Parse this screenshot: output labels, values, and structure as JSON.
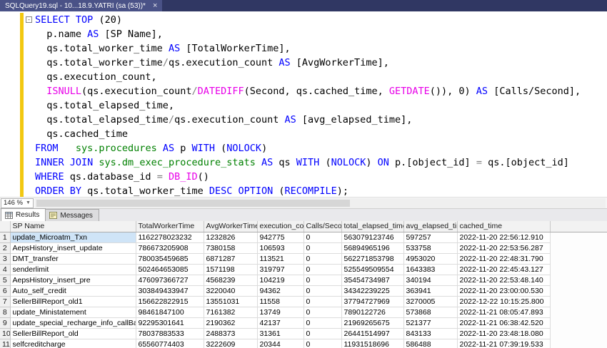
{
  "window": {
    "tab_title": "SQLQuery19.sql - 10...18.9.YATRI (sa (53))*",
    "close_glyph": "×"
  },
  "editor": {
    "zoom": "146 %",
    "code_lines": [
      {
        "fold": "-",
        "tokens": [
          [
            "k",
            "SELECT"
          ],
          [
            "d",
            " "
          ],
          [
            "k",
            "TOP"
          ],
          [
            "d",
            " (20)"
          ]
        ]
      },
      {
        "tokens": [
          [
            "d",
            "  p.name "
          ],
          [
            "k",
            "AS"
          ],
          [
            "d",
            " [SP Name],"
          ]
        ]
      },
      {
        "tokens": [
          [
            "d",
            "  qs.total_worker_time "
          ],
          [
            "k",
            "AS"
          ],
          [
            "d",
            " [TotalWorkerTime],"
          ]
        ]
      },
      {
        "tokens": [
          [
            "d",
            "  qs.total_worker_time"
          ],
          [
            "o",
            "/"
          ],
          [
            "d",
            "qs.execution_count "
          ],
          [
            "k",
            "AS"
          ],
          [
            "d",
            " [AvgWorkerTime],"
          ]
        ]
      },
      {
        "tokens": [
          [
            "d",
            "  qs.execution_count,"
          ]
        ]
      },
      {
        "tokens": [
          [
            "d",
            "  "
          ],
          [
            "f",
            "ISNULL"
          ],
          [
            "d",
            "(qs.execution_count"
          ],
          [
            "o",
            "/"
          ],
          [
            "f",
            "DATEDIFF"
          ],
          [
            "d",
            "(Second, qs.cached_time, "
          ],
          [
            "f",
            "GETDATE"
          ],
          [
            "d",
            "()), 0) "
          ],
          [
            "k",
            "AS"
          ],
          [
            "d",
            " [Calls/Second],"
          ]
        ]
      },
      {
        "tokens": [
          [
            "d",
            "  qs.total_elapsed_time,"
          ]
        ]
      },
      {
        "tokens": [
          [
            "d",
            "  qs.total_elapsed_time"
          ],
          [
            "o",
            "/"
          ],
          [
            "d",
            "qs.execution_count "
          ],
          [
            "k",
            "AS"
          ],
          [
            "d",
            " [avg_elapsed_time],"
          ]
        ]
      },
      {
        "tokens": [
          [
            "d",
            "  qs.cached_time"
          ]
        ]
      },
      {
        "tokens": [
          [
            "k",
            "FROM"
          ],
          [
            "d",
            "   "
          ],
          [
            "s",
            "sys.procedures"
          ],
          [
            "d",
            " "
          ],
          [
            "k",
            "AS"
          ],
          [
            "d",
            " p "
          ],
          [
            "k",
            "WITH"
          ],
          [
            "d",
            " ("
          ],
          [
            "k",
            "NOLOCK"
          ],
          [
            "d",
            ")"
          ]
        ]
      },
      {
        "tokens": [
          [
            "k",
            "INNER JOIN"
          ],
          [
            "d",
            " "
          ],
          [
            "s",
            "sys.dm_exec_procedure_stats"
          ],
          [
            "d",
            " "
          ],
          [
            "k",
            "AS"
          ],
          [
            "d",
            " qs "
          ],
          [
            "k",
            "WITH"
          ],
          [
            "d",
            " ("
          ],
          [
            "k",
            "NOLOCK"
          ],
          [
            "d",
            ") "
          ],
          [
            "k",
            "ON"
          ],
          [
            "d",
            " p.[object_id] "
          ],
          [
            "o",
            "="
          ],
          [
            "d",
            " qs.[object_id]"
          ]
        ]
      },
      {
        "tokens": [
          [
            "k",
            "WHERE"
          ],
          [
            "d",
            " qs.database_id "
          ],
          [
            "o",
            "="
          ],
          [
            "d",
            " "
          ],
          [
            "f",
            "DB_ID"
          ],
          [
            "d",
            "()"
          ]
        ]
      },
      {
        "tokens": [
          [
            "k",
            "ORDER BY"
          ],
          [
            "d",
            " qs.total_worker_time "
          ],
          [
            "k",
            "DESC"
          ],
          [
            "d",
            " "
          ],
          [
            "k",
            "OPTION"
          ],
          [
            "d",
            " ("
          ],
          [
            "k",
            "RECOMPILE"
          ],
          [
            "d",
            ");"
          ]
        ]
      }
    ]
  },
  "results_pane": {
    "tabs": [
      {
        "label": "Results",
        "active": true
      },
      {
        "label": "Messages",
        "active": false
      }
    ]
  },
  "grid": {
    "columns": [
      "SP Name",
      "TotalWorkerTime",
      "AvgWorkerTime",
      "execution_count",
      "Calls/Second",
      "total_elapsed_time",
      "avg_elapsed_time",
      "cached_time"
    ],
    "selected_cell": {
      "row": 0,
      "col": 0
    },
    "rows": [
      [
        "update_Microatm_Txn",
        "1162278023232",
        "1232826",
        "942775",
        "0",
        "563079123746",
        "597257",
        "2022-11-20 22:56:12.910"
      ],
      [
        "AepsHistory_insert_update",
        "786673205908",
        "7380158",
        "106593",
        "0",
        "56894965196",
        "533758",
        "2022-11-20 22:53:56.287"
      ],
      [
        "DMT_transfer",
        "780035459685",
        "6871287",
        "113521",
        "0",
        "562271853798",
        "4953020",
        "2022-11-20 22:48:31.790"
      ],
      [
        "senderlimit",
        "502464653085",
        "1571198",
        "319797",
        "0",
        "525549509554",
        "1643383",
        "2022-11-20 22:45:43.127"
      ],
      [
        "AepsHistory_insert_pre",
        "476097366727",
        "4568239",
        "104219",
        "0",
        "35454734987",
        "340194",
        "2022-11-20 22:53:48.140"
      ],
      [
        "Auto_self_credit",
        "303849433947",
        "3220040",
        "94362",
        "0",
        "34342239225",
        "363941",
        "2022-11-20 23:00:00.530"
      ],
      [
        "SellerBillReport_old1",
        "156622822915",
        "13551031",
        "11558",
        "0",
        "37794727969",
        "3270005",
        "2022-12-22 10:15:25.800"
      ],
      [
        "update_Ministatement",
        "98461847100",
        "7161382",
        "13749",
        "0",
        "7890122726",
        "573868",
        "2022-11-21 08:05:47.893"
      ],
      [
        "update_special_recharge_info_callBack",
        "92295301641",
        "2190362",
        "42137",
        "0",
        "21969265675",
        "521377",
        "2022-11-21 06:38:42.520"
      ],
      [
        "SellerBillReport_old",
        "78037883533",
        "2488373",
        "31361",
        "0",
        "26441514997",
        "843133",
        "2022-11-20 23:48:18.080"
      ],
      [
        "selfcreditcharge",
        "65560774403",
        "3222609",
        "20344",
        "0",
        "11931518696",
        "586488",
        "2022-11-21 07:39:19.533"
      ]
    ]
  }
}
